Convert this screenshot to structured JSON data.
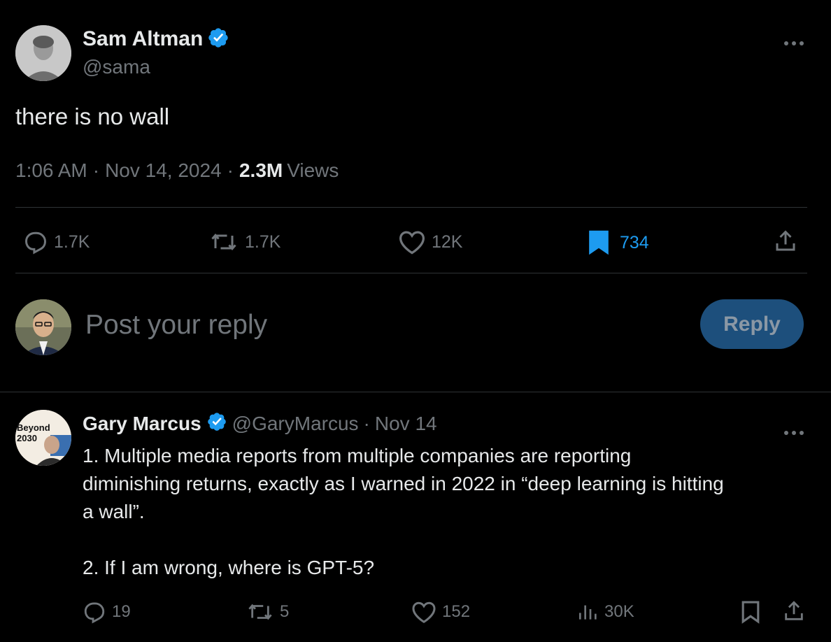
{
  "main_post": {
    "author_name": "Sam Altman",
    "handle": "@sama",
    "text": "there is no wall",
    "time": "1:06 AM",
    "separator": "·",
    "date": "Nov 14, 2024",
    "views_count": "2.3M",
    "views_label": "Views",
    "stats": {
      "replies": "1.7K",
      "reposts": "1.7K",
      "likes": "12K",
      "bookmarks": "734"
    },
    "accent_color": "#1d9bf0"
  },
  "composer": {
    "placeholder": "Post your reply",
    "reply_button": "Reply"
  },
  "reply_post": {
    "author_name": "Gary Marcus",
    "handle": "@GaryMarcus",
    "separator": "·",
    "date": "Nov 14",
    "avatar_text": "Beyond 2030",
    "lines": [
      "1. Multiple media reports from multiple companies are reporting",
      "diminishing returns, exactly as I warned in 2022 in “deep learning is hitting",
      "a wall”.",
      "2. If I am wrong, where is GPT-5?"
    ],
    "stats": {
      "replies": "19",
      "reposts": "5",
      "likes": "152",
      "views": "30K"
    }
  },
  "icons": [
    "verified-badge-icon",
    "more-icon",
    "reply-icon",
    "repost-icon",
    "like-icon",
    "bookmark-icon",
    "share-icon",
    "views-icon"
  ]
}
